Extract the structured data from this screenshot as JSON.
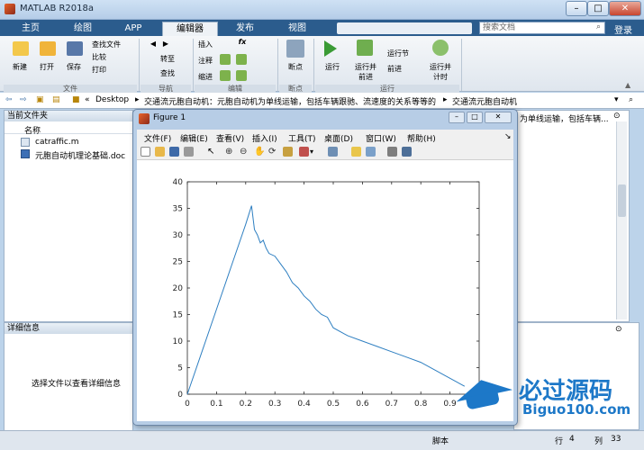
{
  "app": {
    "title": "MATLAB R2018a"
  },
  "tabs": [
    "主页",
    "绘图",
    "APP",
    "编辑器",
    "发布",
    "视图"
  ],
  "search_placeholder": "搜索文档",
  "login_label": "登录",
  "ribbon": {
    "file": {
      "new": "新建",
      "open": "打开",
      "save": "保存",
      "find_files": "查找文件",
      "compare": "比较",
      "print": "打印",
      "section": "文件"
    },
    "navigate": {
      "goto": "转至",
      "find": "查找",
      "section": "导航"
    },
    "edit": {
      "insert": "插入",
      "fx": "fx",
      "comment": "注释",
      "indent": "缩进",
      "section": "编辑"
    },
    "breakpoints": {
      "label": "断点",
      "section": "断点"
    },
    "run": {
      "run": "运行",
      "run_advance": "运行并\n前进",
      "run_section": "运行节",
      "advance": "前进",
      "run_time": "运行并\n计时",
      "section": "运行"
    }
  },
  "address": {
    "parts": [
      "«",
      "Desktop",
      "▸",
      "交通流元胞自动机：元胞自动机为单线运输，包括车辆跟驰、流速度的关系等等的",
      "▸",
      "交通流元胞自动机"
    ]
  },
  "left_panel": {
    "title": "当前文件夹",
    "column": "名称",
    "files": [
      "catraffic.m",
      "元胞自动机理论基础.doc"
    ]
  },
  "details_panel": {
    "title": "详细信息",
    "hint": "选择文件以查看详细信息"
  },
  "right_panel": {
    "text": "为单线运输，包括车辆..."
  },
  "status": {
    "mode": "脚本",
    "row_label": "行",
    "row": "4",
    "col_label": "列",
    "col": "33"
  },
  "figure": {
    "title": "Figure 1",
    "menu": [
      "文件(F)",
      "编辑(E)",
      "查看(V)",
      "插入(I)",
      "工具(T)",
      "桌面(D)",
      "窗口(W)",
      "帮助(H)"
    ]
  },
  "watermark": {
    "cn": "必过源码",
    "en": "Biguo100.com"
  },
  "chart_data": {
    "type": "line",
    "title": "",
    "xlabel": "",
    "ylabel": "",
    "xlim": [
      0,
      1
    ],
    "ylim": [
      0,
      40
    ],
    "xticks": [
      0,
      0.1,
      0.2,
      0.3,
      0.4,
      0.5,
      0.6,
      0.7,
      0.8,
      0.9
    ],
    "yticks": [
      0,
      5,
      10,
      15,
      20,
      25,
      30,
      35,
      40
    ],
    "series": [
      {
        "color": "#2e7fc1",
        "x": [
          0,
          0.05,
          0.1,
          0.15,
          0.2,
          0.22,
          0.23,
          0.24,
          0.25,
          0.26,
          0.27,
          0.28,
          0.3,
          0.32,
          0.34,
          0.36,
          0.38,
          0.4,
          0.42,
          0.44,
          0.46,
          0.48,
          0.5,
          0.55,
          0.6,
          0.65,
          0.7,
          0.75,
          0.8,
          0.85,
          0.9,
          0.95
        ],
        "y": [
          0,
          8,
          16,
          24,
          32,
          35.5,
          31,
          30,
          28.5,
          29,
          27.5,
          26.5,
          26,
          24.5,
          23,
          21,
          20,
          18.5,
          17.5,
          16,
          15,
          14.5,
          12.5,
          11,
          10,
          9,
          8,
          7,
          6,
          4.5,
          3,
          1.5
        ]
      }
    ]
  }
}
